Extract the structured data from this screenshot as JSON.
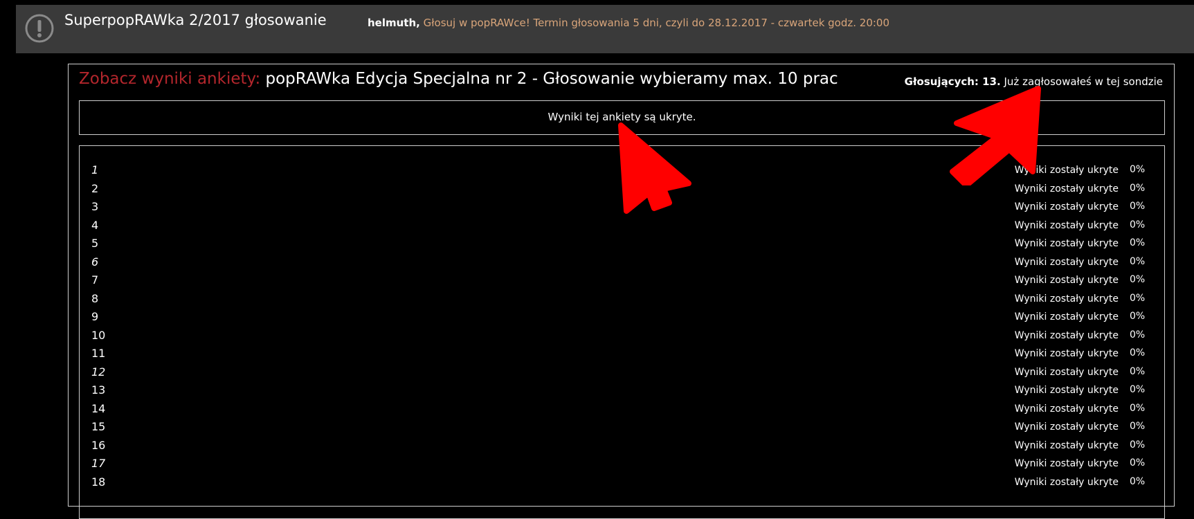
{
  "notice": {
    "icon": "exclamation-circle-icon",
    "title": "SuperpopRAWka 2/2017 głosowanie",
    "user": "helmuth,",
    "message": " Głosuj w popRAWce! Termin głosowania 5 dni, czyli do 28.12.2017 - czwartek godz. 20:00"
  },
  "poll": {
    "prefix": "Zobacz wyniki ankiety:",
    "question": "popRAWka Edycja Specjalna nr 2 - Głosowanie wybieramy max. 10 prac",
    "voters_label": "Głosujących: 13.",
    "voted_text": " Już zagłosowałeś w tej sondzie",
    "hidden_notice": "Wyniki tej ankiety są ukryte."
  },
  "options": [
    {
      "label": "1",
      "italic": true,
      "result": "Wyniki zostały ukryte",
      "percent": "0%"
    },
    {
      "label": "2",
      "italic": false,
      "result": "Wyniki zostały ukryte",
      "percent": "0%"
    },
    {
      "label": "3",
      "italic": false,
      "result": "Wyniki zostały ukryte",
      "percent": "0%"
    },
    {
      "label": "4",
      "italic": false,
      "result": "Wyniki zostały ukryte",
      "percent": "0%"
    },
    {
      "label": "5",
      "italic": false,
      "result": "Wyniki zostały ukryte",
      "percent": "0%"
    },
    {
      "label": "6",
      "italic": true,
      "result": "Wyniki zostały ukryte",
      "percent": "0%"
    },
    {
      "label": "7",
      "italic": false,
      "result": "Wyniki zostały ukryte",
      "percent": "0%"
    },
    {
      "label": "8",
      "italic": false,
      "result": "Wyniki zostały ukryte",
      "percent": "0%"
    },
    {
      "label": "9",
      "italic": false,
      "result": "Wyniki zostały ukryte",
      "percent": "0%"
    },
    {
      "label": "10",
      "italic": false,
      "result": "Wyniki zostały ukryte",
      "percent": "0%"
    },
    {
      "label": "11",
      "italic": false,
      "result": "Wyniki zostały ukryte",
      "percent": "0%"
    },
    {
      "label": "12",
      "italic": true,
      "result": "Wyniki zostały ukryte",
      "percent": "0%"
    },
    {
      "label": "13",
      "italic": false,
      "result": "Wyniki zostały ukryte",
      "percent": "0%"
    },
    {
      "label": "14",
      "italic": false,
      "result": "Wyniki zostały ukryte",
      "percent": "0%"
    },
    {
      "label": "15",
      "italic": false,
      "result": "Wyniki zostały ukryte",
      "percent": "0%"
    },
    {
      "label": "16",
      "italic": false,
      "result": "Wyniki zostały ukryte",
      "percent": "0%"
    },
    {
      "label": "17",
      "italic": true,
      "result": "Wyniki zostały ukryte",
      "percent": "0%"
    },
    {
      "label": "18",
      "italic": false,
      "result": "Wyniki zostały ukryte",
      "percent": "0%"
    }
  ],
  "colors": {
    "notice_bg": "#3a3a3a",
    "notice_text": "#d9a57a",
    "prefix": "#b3262c",
    "arrow": "#ff0000"
  },
  "annotations": [
    "arrow-icon",
    "arrow-icon"
  ]
}
